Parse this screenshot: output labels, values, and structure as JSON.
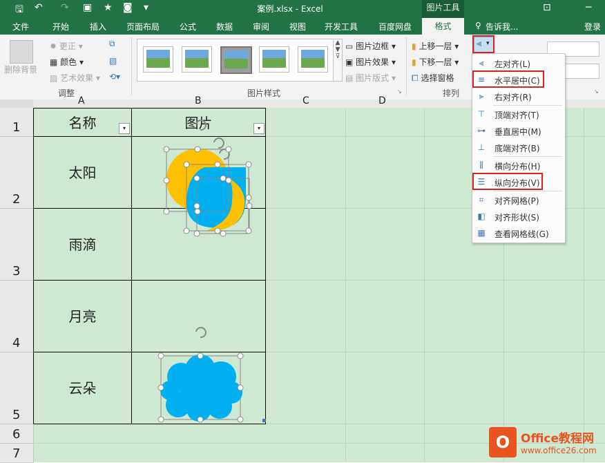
{
  "titlebar": {
    "title": "案例.xlsx - Excel",
    "context_label": "图片工具"
  },
  "tabs": [
    {
      "label": "文件"
    },
    {
      "label": "开始"
    },
    {
      "label": "插入"
    },
    {
      "label": "页面布局"
    },
    {
      "label": "公式"
    },
    {
      "label": "数据"
    },
    {
      "label": "审阅"
    },
    {
      "label": "视图"
    },
    {
      "label": "开发工具"
    },
    {
      "label": "百度网盘"
    }
  ],
  "format_tab": "格式",
  "tell_me": "告诉我...",
  "login": "登录",
  "ribbon": {
    "remove_bg": "删除背景",
    "corrections": "更正",
    "color": "颜色",
    "art_effects": "艺术效果",
    "adjust_group": "调整",
    "border": "图片边框",
    "effects": "图片效果",
    "layout": "图片版式",
    "styles_group": "图片样式",
    "bring_forward": "上移一层",
    "send_backward": "下移一层",
    "selection_pane": "选择窗格",
    "arrange_group": "排列"
  },
  "columns": [
    "A",
    "B",
    "C",
    "D"
  ],
  "rows": [
    {
      "num": "1"
    },
    {
      "num": "2"
    },
    {
      "num": "3"
    },
    {
      "num": "4"
    },
    {
      "num": "5"
    },
    {
      "num": "6"
    },
    {
      "num": "7"
    }
  ],
  "cells": {
    "a1": "名称",
    "b1": "图片",
    "a2": "太阳",
    "a3": "雨滴",
    "a4": "月亮",
    "a5": "云朵"
  },
  "menu": [
    {
      "label": "左对齐(L)",
      "icon": "align-left-icon"
    },
    {
      "label": "水平居中(C)",
      "icon": "align-center-icon"
    },
    {
      "label": "右对齐(R)",
      "icon": "align-right-icon"
    },
    {
      "label": "顶端对齐(T)",
      "icon": "align-top-icon"
    },
    {
      "label": "垂直居中(M)",
      "icon": "align-middle-icon"
    },
    {
      "label": "底端对齐(B)",
      "icon": "align-bottom-icon"
    },
    {
      "label": "横向分布(H)",
      "icon": "distribute-horizontal-icon"
    },
    {
      "label": "纵向分布(V)",
      "icon": "distribute-vertical-icon"
    },
    {
      "label": "对齐网格(P)",
      "icon": "snap-grid-icon"
    },
    {
      "label": "对齐形状(S)",
      "icon": "snap-shape-icon"
    },
    {
      "label": "查看网格线(G)",
      "icon": "view-gridlines-icon"
    }
  ],
  "watermark": {
    "brand": "Office教程网",
    "url": "www.office26.com"
  },
  "colors": {
    "excel_green": "#217346",
    "sun": "#ffc000",
    "shape_blue": "#00b0f0",
    "sheet_bg": "#cfe8d2",
    "highlight": "#e02020"
  }
}
